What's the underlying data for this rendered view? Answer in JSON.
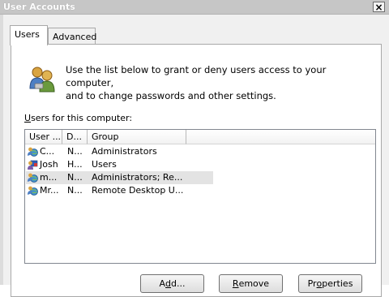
{
  "window": {
    "title": "User Accounts",
    "close_glyph": "×"
  },
  "tabs": [
    {
      "label": "Users",
      "active": true
    },
    {
      "label": "Advanced",
      "active": false
    }
  ],
  "description": {
    "line1": "Use the list below to grant or deny users access to your computer,",
    "line2": "and to change passwords and other settings.",
    "icon": "users-icon"
  },
  "list": {
    "label_key": "U",
    "label_rest": "sers for this computer:",
    "columns": [
      "User ...",
      "D...",
      "Group"
    ],
    "rows": [
      {
        "user": "C...",
        "domain": "N...",
        "group": "Administrators",
        "icon": "user-globe-icon",
        "selected": false
      },
      {
        "user": "Josh",
        "domain": "H...",
        "group": "Users",
        "icon": "user-flag-icon",
        "selected": false
      },
      {
        "user": "m...",
        "domain": "N...",
        "group": "Administrators; Re...",
        "icon": "user-globe-icon",
        "selected": true
      },
      {
        "user": "Mr...",
        "domain": "N...",
        "group": "Remote Desktop U...",
        "icon": "user-globe-icon",
        "selected": false
      }
    ]
  },
  "buttons": {
    "add": {
      "pre": "A",
      "key": "d",
      "post": "d..."
    },
    "remove": {
      "pre": "",
      "key": "R",
      "post": "emove"
    },
    "properties": {
      "pre": "Pr",
      "key": "o",
      "post": "perties"
    }
  },
  "colors": {
    "titlebar": "#c6c6c6",
    "dialog_bg": "#f0f0f0",
    "panel_bg": "#ffffff",
    "selected_row": "#e3e3e3"
  }
}
